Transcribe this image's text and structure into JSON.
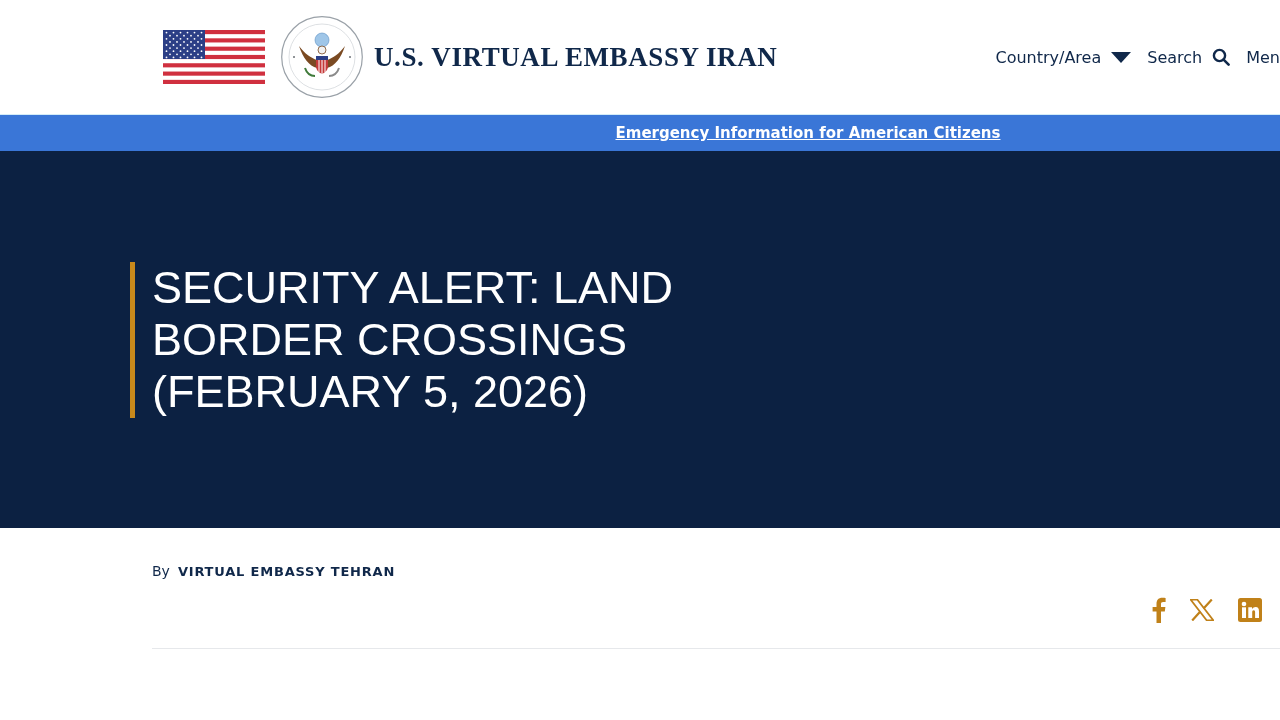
{
  "header": {
    "site_title": "U.S. VIRTUAL EMBASSY IRAN",
    "nav": [
      {
        "label": "Country/Area",
        "kind": "dropdown"
      },
      {
        "label": "Search",
        "kind": "search"
      },
      {
        "label": "Men",
        "kind": "menu"
      }
    ]
  },
  "alert_banner": {
    "link": "Emergency Information for American Citizens"
  },
  "hero": {
    "title": "SECURITY ALERT: LAND BORDER CROSSINGS (FEBRUARY 5, 2026)"
  },
  "byline": {
    "prefix": "By",
    "author": "VIRTUAL EMBASSY TEHRAN"
  }
}
